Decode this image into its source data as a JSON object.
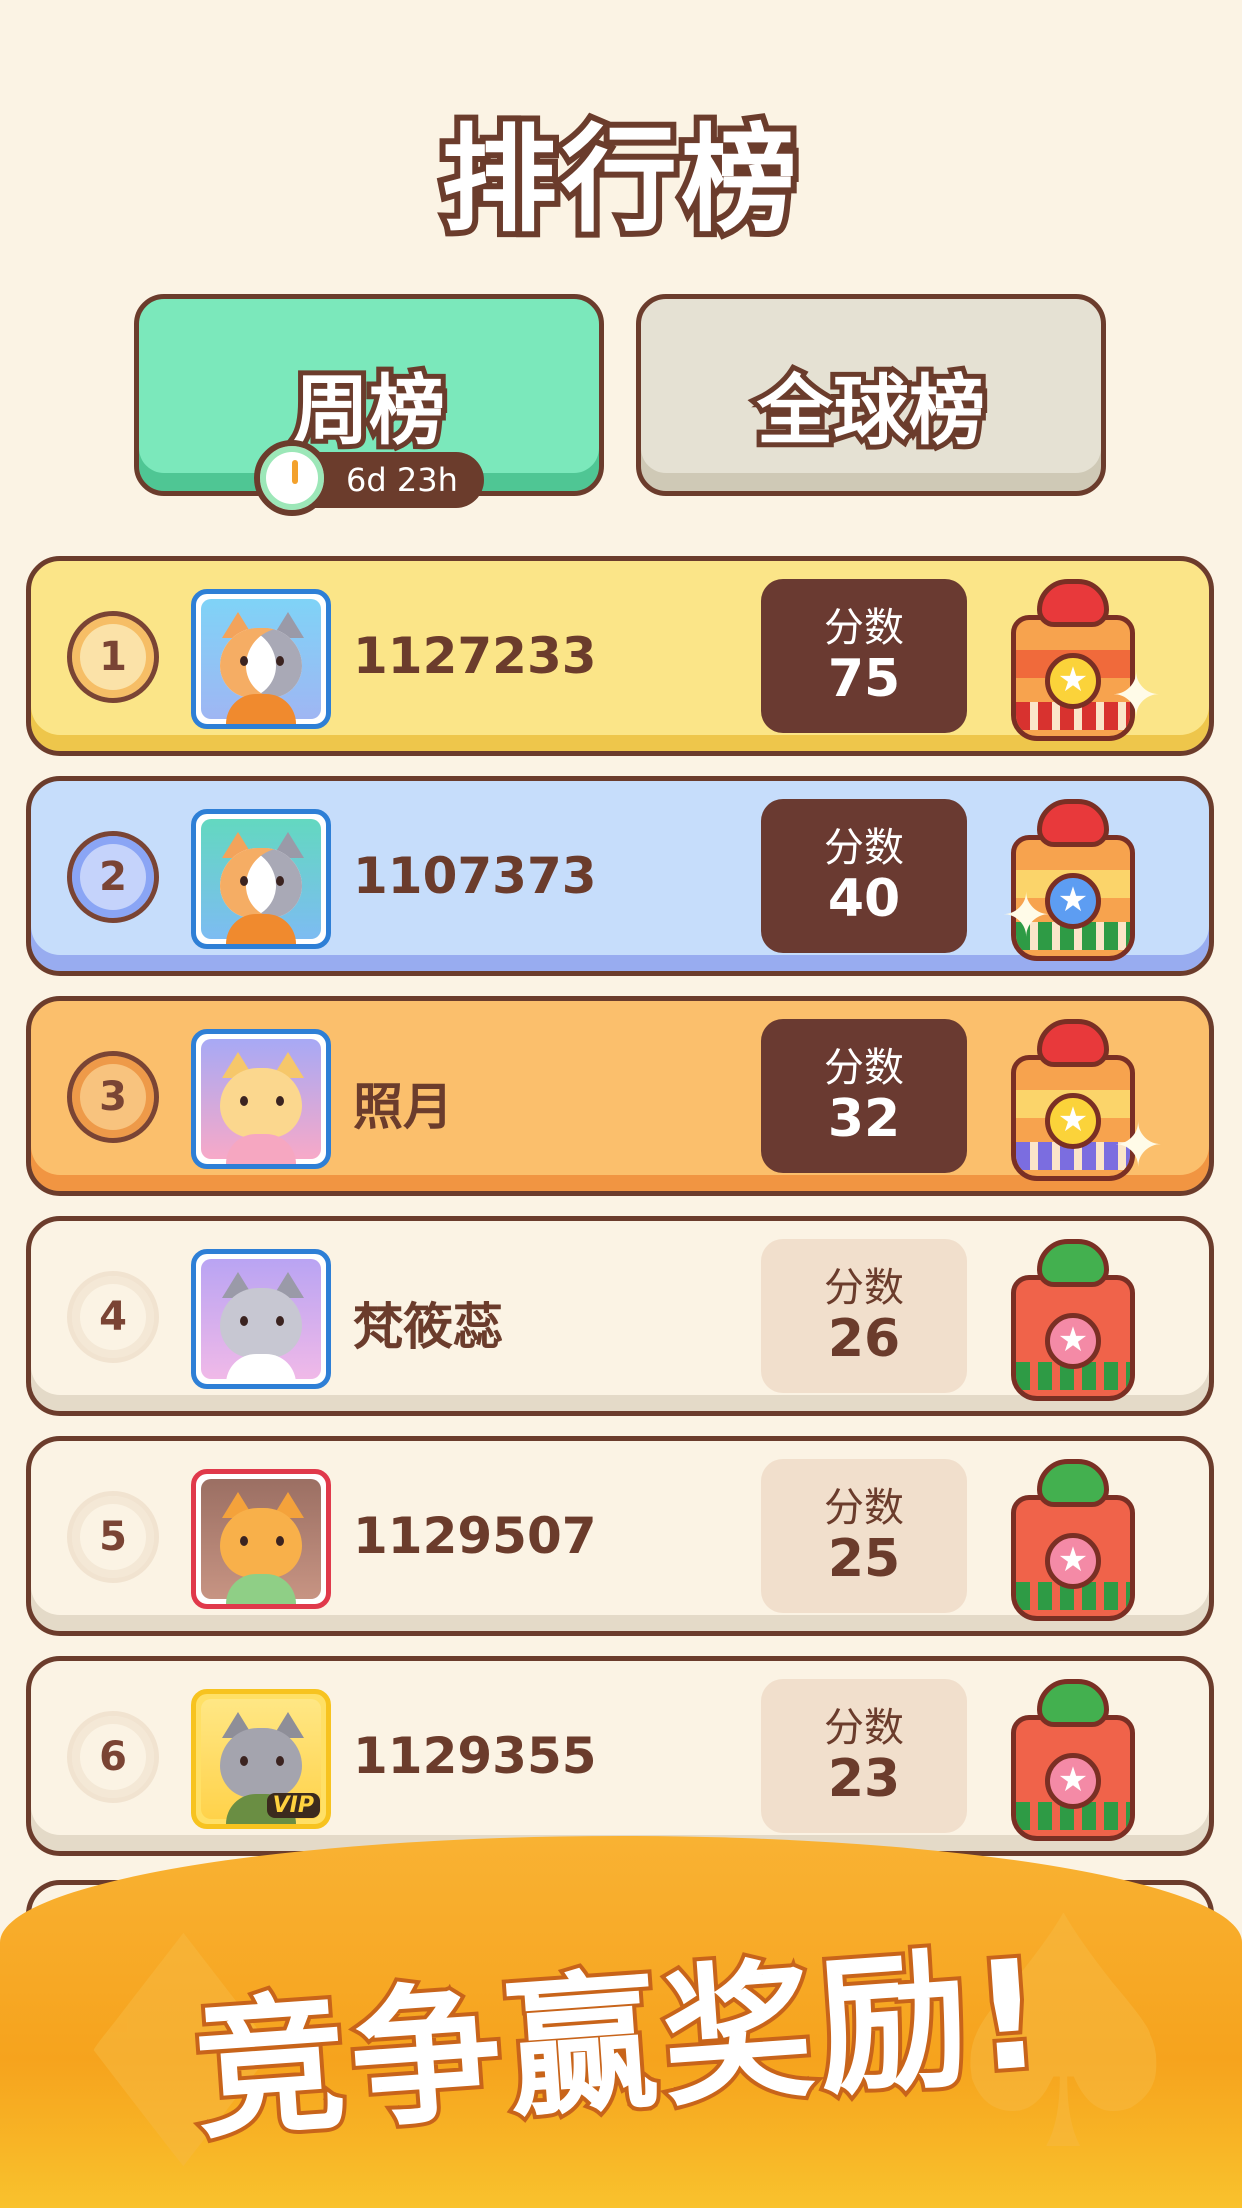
{
  "title": "排行榜",
  "tabs": {
    "weekly": {
      "label": "周榜",
      "timer": "6d 23h",
      "active": true
    },
    "global": {
      "label": "全球榜",
      "active": false
    }
  },
  "score_label": "分数",
  "rows": [
    {
      "rank": "1",
      "name": "1127233",
      "score": "75",
      "tier": "gold"
    },
    {
      "rank": "2",
      "name": "1107373",
      "score": "40",
      "tier": "silver"
    },
    {
      "rank": "3",
      "name": "照月",
      "score": "32",
      "tier": "bronze"
    },
    {
      "rank": "4",
      "name": "梵筱蕊",
      "score": "26",
      "tier": "plain"
    },
    {
      "rank": "5",
      "name": "1129507",
      "score": "25",
      "tier": "plain"
    },
    {
      "rank": "6",
      "name": "1129355",
      "score": "23",
      "tier": "plain",
      "vip": "VIP"
    }
  ],
  "banner": {
    "text": "竞争赢奖励!"
  },
  "colors": {
    "background": "#fbf3e4",
    "outline": "#6b3c2c",
    "tab_active": "#7be8bb",
    "tab_inactive": "#e5e1d3",
    "gold_row": "#fbe588",
    "silver_row": "#c6ddfb",
    "bronze_row": "#fbbf6c",
    "banner": "#f6a31d"
  }
}
